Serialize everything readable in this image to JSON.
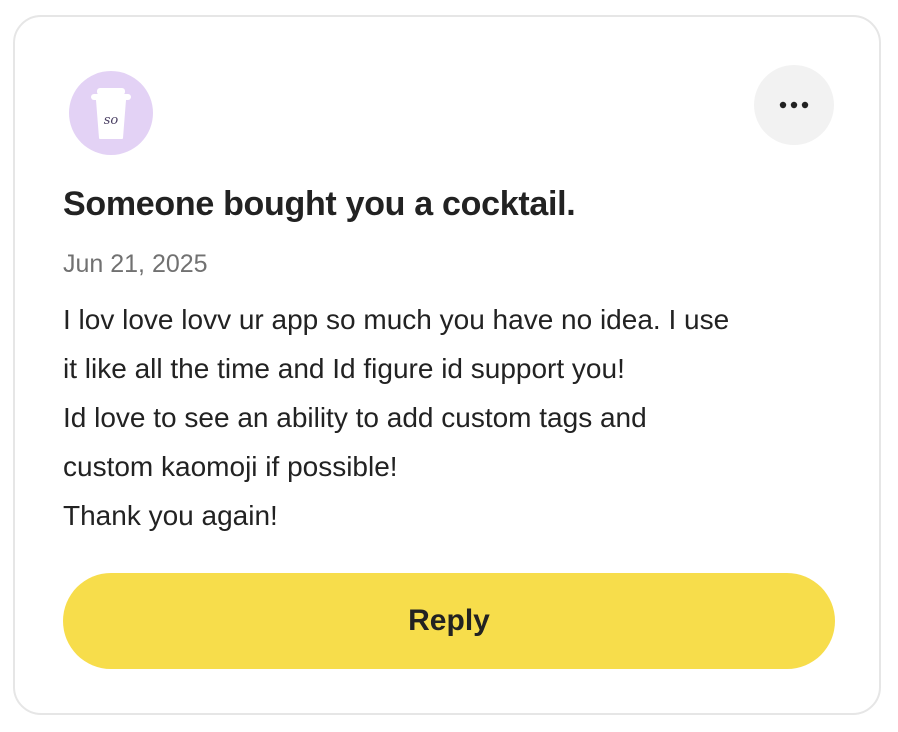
{
  "card": {
    "avatar_icon": "coffee-cup-icon",
    "avatar_initials": "so",
    "more_icon": "more-horizontal-icon",
    "title": "Someone bought you a cocktail.",
    "date": "Jun 21, 2025",
    "message_lines": [
      "I lov love lovv ur app so much you have no idea. I use",
      "it like all the time and Id figure id support you!",
      "Id love to see an ability to add custom tags and",
      "custom kaomoji if possible!",
      "Thank you again!"
    ],
    "reply_label": "Reply"
  },
  "colors": {
    "avatar_bg": "#e3d2f5",
    "reply_button": "#f7dd4b",
    "more_button_bg": "#f2f2f2",
    "text": "#222222",
    "date_text": "#717171"
  }
}
